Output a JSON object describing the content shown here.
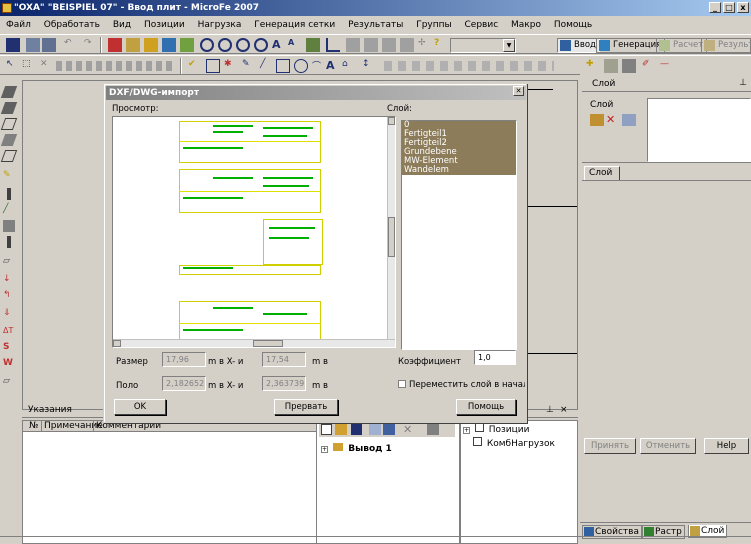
{
  "window": {
    "title": "\"OXA\" \"BEISPIEL 07\" - Ввод плит - MicroFe 2007",
    "controls": [
      "_",
      "□",
      "x"
    ]
  },
  "menu": [
    {
      "label": "Файл"
    },
    {
      "label": "Обработать"
    },
    {
      "label": "Вид"
    },
    {
      "label": "Позиции"
    },
    {
      "label": "Нагрузка"
    },
    {
      "label": "Генерация сетки"
    },
    {
      "label": "Результаты"
    },
    {
      "label": "Группы"
    },
    {
      "label": "Сервис"
    },
    {
      "label": "Макро"
    },
    {
      "label": "Помощь"
    }
  ],
  "mode_tabs": {
    "input": "Ввод",
    "generation": "Генерация",
    "calculation": "Расчет",
    "results": "Результаты"
  },
  "right_panel": {
    "layer_header": "Слой",
    "layer_label": "Слой",
    "layer_tab": "Слой",
    "apply_button": "Принять",
    "cancel_button": "Отменить",
    "help_button": "Help",
    "bottom_tabs": [
      "Свойства",
      "Растр",
      "Слой"
    ]
  },
  "dialog": {
    "title": "DXF/DWG-импорт",
    "preview_label": "Просмотр:",
    "layer_label": "Слой:",
    "layers": [
      "0",
      "Fertigteil1",
      "Fertigteil2",
      "Grundebene",
      "MW-Element",
      "Wandelem"
    ],
    "size_label": "Размер",
    "size_x": "17,96",
    "size_unit_x": "m в X- и",
    "size_y": "17,54",
    "size_unit_y": "m в",
    "pole_label": "Поло",
    "pole_x": "2,182652",
    "pole_unit_x": "m в X- и",
    "pole_y": "2,363739",
    "pole_unit_y": "m в",
    "coef_label": "Коэффициент",
    "coef_value": "1,0",
    "move_layer_label": "Переместить слой в начало к",
    "ok_button": "OK",
    "cancel_button": "Прервать",
    "help_button": "Помощь"
  },
  "ukazania": {
    "title": "Указания",
    "col_no": "№",
    "col_note": "Примечание",
    "col_comment": "Комментарии",
    "close": "× ",
    "pin": "⊥"
  },
  "output_panel": {
    "tree_item": "Вывод 1"
  },
  "positions_panel": {
    "close": "×",
    "pin": "⊥",
    "item1": "Позиции",
    "item2": "КомбНагрузок"
  }
}
